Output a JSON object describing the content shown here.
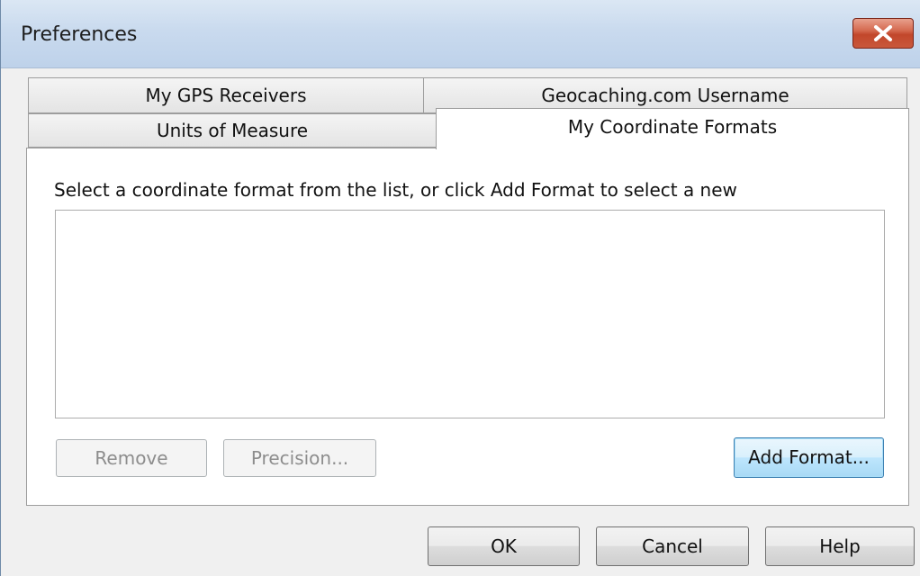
{
  "window": {
    "title": "Preferences"
  },
  "tabs": {
    "gps_receivers": "My GPS Receivers",
    "geocaching_username": "Geocaching.com Username",
    "units_of_measure": "Units of Measure",
    "coordinate_formats": "My Coordinate Formats",
    "active": "My Coordinate Formats"
  },
  "panel": {
    "instruction": "Select a coordinate format from the list, or click Add Format to select a new",
    "formats": [],
    "remove_label": "Remove",
    "precision_label": "Precision...",
    "add_format_label": "Add Format..."
  },
  "footer": {
    "ok_label": "OK",
    "cancel_label": "Cancel",
    "help_label": "Help"
  },
  "icons": {
    "close": "close-icon"
  },
  "colors": {
    "close_button": "#c9583c",
    "default_button_border": "#3c7fb1",
    "disabled_text": "#8d8d8d"
  }
}
